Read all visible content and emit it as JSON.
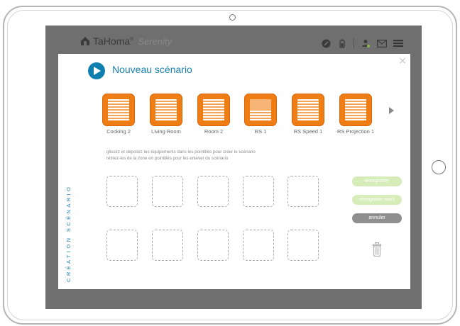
{
  "app": {
    "brand": "TaHoma",
    "brand_reg": "®",
    "brand_sub": "Serenity",
    "icons": [
      "house-icon",
      "settings-icon",
      "battery-icon",
      "user-icon",
      "mail-icon",
      "menu-icon"
    ]
  },
  "modal": {
    "title": "Nouveau scénario",
    "close": "×",
    "side_label": "CRÉATION SCÉNARIO",
    "instructions": [
      "glissez et déposez les équipements dans les pointillés pour créer le scénario",
      "retirez-les de la zone en pointillés pour les enlever du scénario"
    ],
    "devices": [
      {
        "label": "Cooking 2",
        "closed_fraction": 0
      },
      {
        "label": "Living Room",
        "closed_fraction": 0
      },
      {
        "label": "Room 2",
        "closed_fraction": 0
      },
      {
        "label": "RS 1",
        "closed_fraction": 0.5
      },
      {
        "label": "RS Speed 1",
        "closed_fraction": 0
      },
      {
        "label": "RS Projection 1",
        "closed_fraction": 0
      }
    ],
    "buttons": {
      "save": "enregistrer",
      "save_as": "enregistrer sous",
      "cancel": "annuler"
    }
  },
  "colors": {
    "accent": "#1a7fb0",
    "device_tile": "#f07d14",
    "frame_bg": "#6f6f6f",
    "save_button": "#d6edb9",
    "cancel_button": "#8f8f8f"
  }
}
